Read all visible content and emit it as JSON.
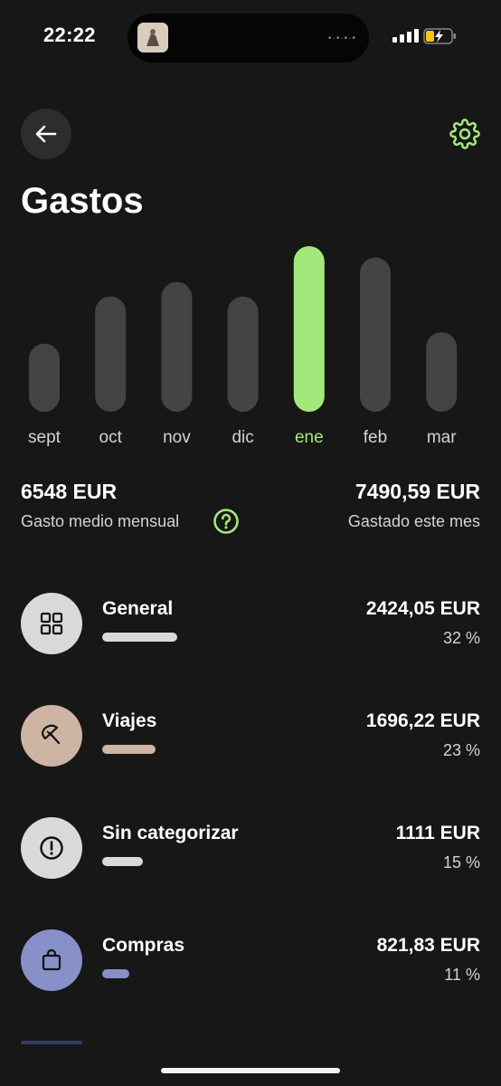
{
  "status_bar": {
    "time": "22:22"
  },
  "header": {
    "title": "Gastos"
  },
  "chart_data": {
    "type": "bar",
    "categories": [
      "sept",
      "oct",
      "nov",
      "dic",
      "ene",
      "feb",
      "mar"
    ],
    "values": [
      4200,
      7100,
      8000,
      7100,
      10200,
      9500,
      4900
    ],
    "selected": "ene",
    "colors": {
      "bar": "#434543",
      "selected": "#a3e87a",
      "label": "#d4d4d4"
    }
  },
  "summary": {
    "avg_value": "6548 EUR",
    "avg_label": "Gasto medio mensual",
    "month_value": "7490,59 EUR",
    "month_label": "Gastado este mes"
  },
  "categories": [
    {
      "name": "General",
      "amount": "2424,05 EUR",
      "percent": "32 %",
      "share": 0.32,
      "icon": "grid-icon",
      "color": "#d9d9d7"
    },
    {
      "name": "Viajes",
      "amount": "1696,22 EUR",
      "percent": "23 %",
      "share": 0.23,
      "icon": "umbrella-icon",
      "color": "#ceb4a3"
    },
    {
      "name": "Sin categorizar",
      "amount": "1111 EUR",
      "percent": "15 %",
      "share": 0.15,
      "icon": "alert-icon",
      "color": "#d9d9d7"
    },
    {
      "name": "Compras",
      "amount": "821,83 EUR",
      "percent": "11 %",
      "share": 0.11,
      "icon": "shopping-bag-icon",
      "color": "#8790c9"
    }
  ],
  "colors": {
    "accent": "#a3e87a",
    "background": "#161716"
  }
}
